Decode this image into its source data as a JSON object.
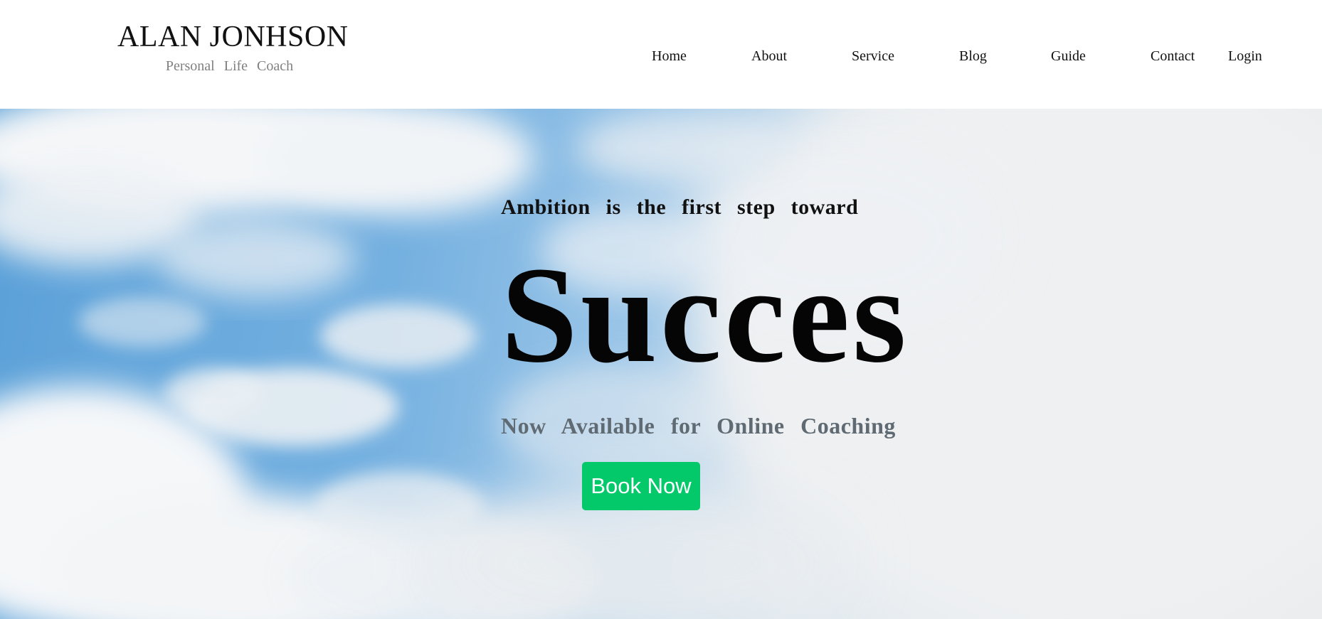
{
  "header": {
    "brand_name": "ALAN JONHSON",
    "brand_tagline": "Personal Life Coach",
    "nav": {
      "home": "Home",
      "about": "About",
      "service": "Service",
      "blog": "Blog",
      "guide": "Guide",
      "contact": "Contact",
      "login": "Login"
    }
  },
  "hero": {
    "kicker": "Ambition is the first step toward",
    "headline": "Succes",
    "subheadline": "Now Available for Online Coaching",
    "cta_label": "Book Now",
    "background": "sky-with-clouds",
    "colors": {
      "cta_background": "#04c96a",
      "cta_text": "#ffffff",
      "subheadline": "#5f6a72"
    }
  }
}
